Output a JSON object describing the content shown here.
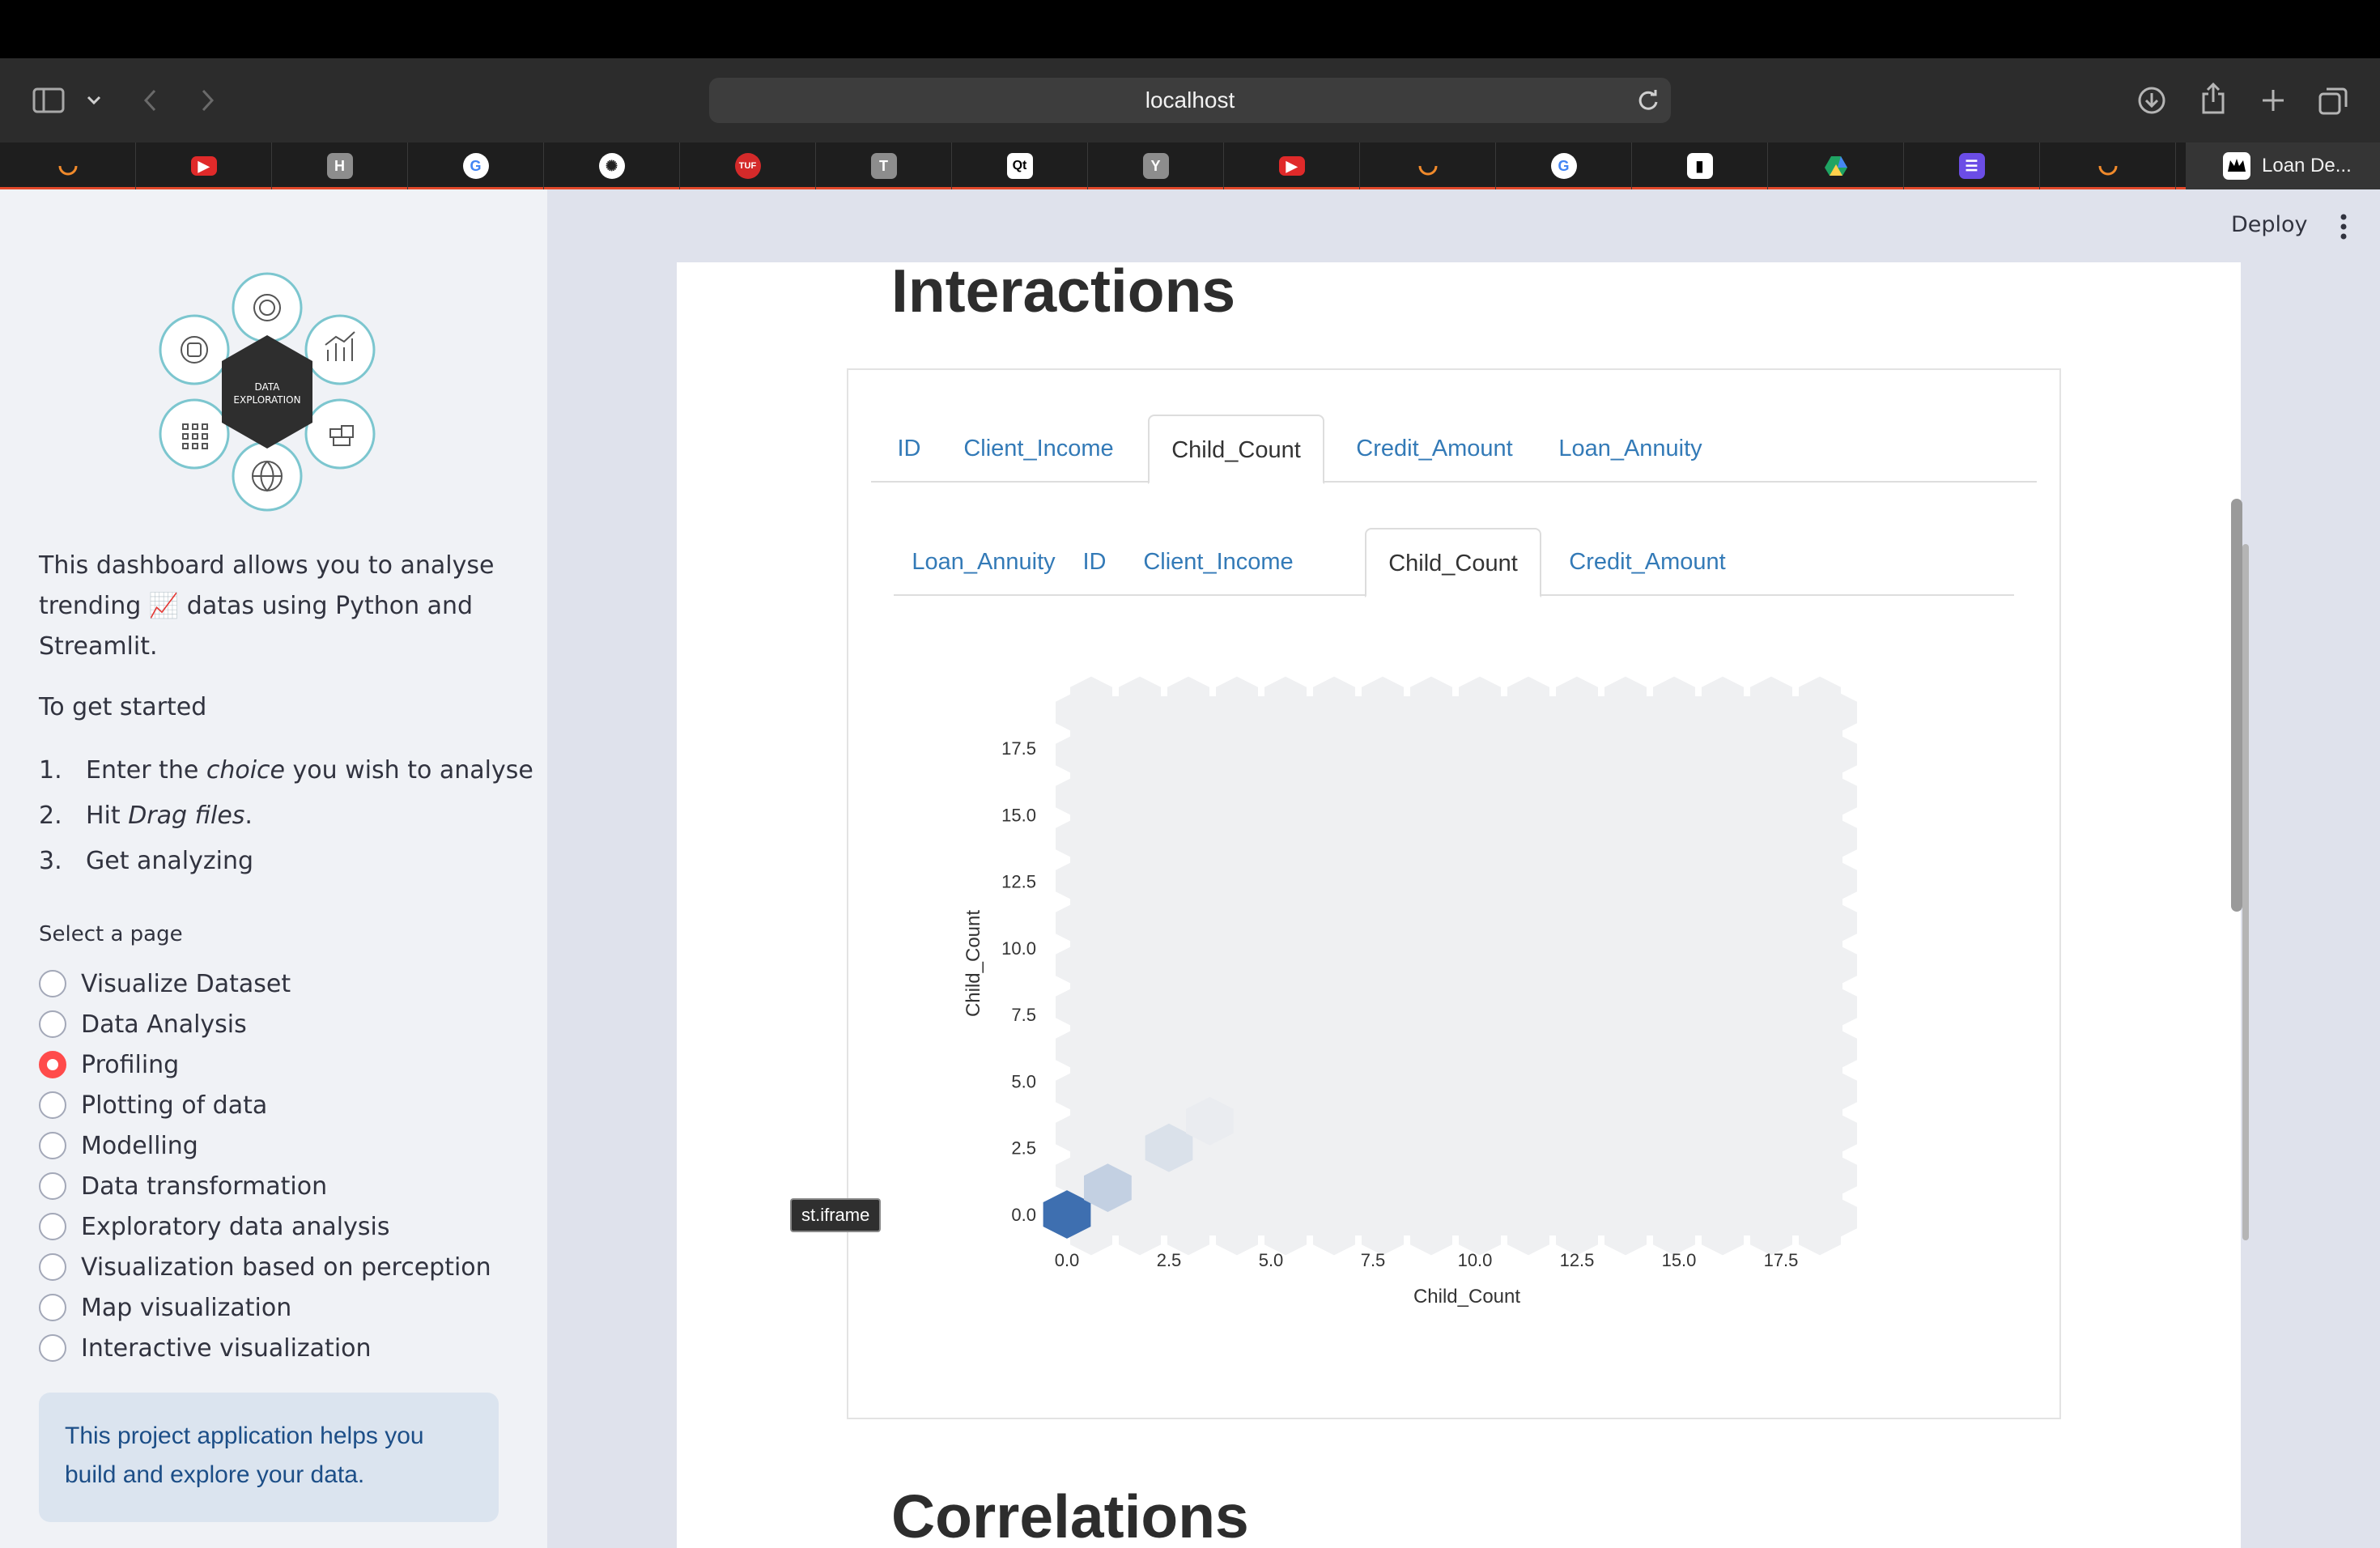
{
  "browser": {
    "url": "localhost",
    "active_tab_title": "Loan De...",
    "favicons": [
      "arc-icon",
      "youtube-icon",
      "h-icon",
      "google-icon",
      "openai-icon",
      "tuf-icon",
      "t-icon",
      "qt-icon",
      "y-icon",
      "youtube-icon",
      "arc-icon",
      "google-icon",
      "analytics-icon",
      "drive-icon",
      "list-icon",
      "arc-icon"
    ]
  },
  "header": {
    "deploy_label": "Deploy"
  },
  "sidebar": {
    "logo_text": [
      "DATA",
      "EXPLORATION"
    ],
    "intro": {
      "line1": "This dashboard allows you to analyse",
      "line2a": "trending ",
      "emoji": "📈",
      "line2b": " datas using Python and",
      "line3": "Streamlit."
    },
    "get_started": "To get started",
    "steps": [
      {
        "num": "1.",
        "pre": "Enter the ",
        "em": "choice",
        "post": " you wish to analyse"
      },
      {
        "num": "2.",
        "pre": "Hit ",
        "em": "Drag files",
        "post": "."
      },
      {
        "num": "3.",
        "pre": "Get analyzing",
        "em": "",
        "post": ""
      }
    ],
    "select_label": "Select a page",
    "pages": [
      "Visualize Dataset",
      "Data Analysis",
      "Profiling",
      "Plotting of data",
      "Modelling",
      "Data transformation",
      "Exploratory data analysis",
      "Visualization based on perception",
      "Map visualization",
      "Interactive visualization"
    ],
    "selected_page": "Profiling",
    "info_line1": "This project application helps you",
    "info_line2": "build and explore your data."
  },
  "main": {
    "section_title": "Interactions",
    "next_section_title": "Correlations",
    "outer_tabs": [
      "ID",
      "Client_Income",
      "Child_Count",
      "Credit_Amount",
      "Loan_Annuity"
    ],
    "outer_active": "Child_Count",
    "inner_tabs": [
      "Loan_Annuity",
      "ID",
      "Client_Income",
      "Child_Count",
      "Credit_Amount"
    ],
    "inner_active": "Child_Count",
    "tooltip": "st.iframe"
  },
  "chart_data": {
    "type": "heatmap",
    "subtype": "hexbin",
    "xlabel": "Child_Count",
    "ylabel": "Child_Count",
    "xlim": [
      0,
      19
    ],
    "ylim": [
      0,
      19
    ],
    "xticks": [
      "0.0",
      "2.5",
      "5.0",
      "7.5",
      "10.0",
      "12.5",
      "15.0",
      "17.5"
    ],
    "yticks": [
      "0.0",
      "2.5",
      "5.0",
      "7.5",
      "10.0",
      "12.5",
      "15.0",
      "17.5"
    ],
    "bins": [
      {
        "x": 0,
        "y": 0,
        "intensity": 1.0
      },
      {
        "x": 1,
        "y": 1,
        "intensity": 0.25
      },
      {
        "x": 2.5,
        "y": 2.5,
        "intensity": 0.12
      },
      {
        "x": 3.5,
        "y": 3.5,
        "intensity": 0.03
      }
    ],
    "colors": {
      "background": "#eff0f2",
      "max": "#3e6fb0",
      "min": "#eff0f2"
    }
  }
}
